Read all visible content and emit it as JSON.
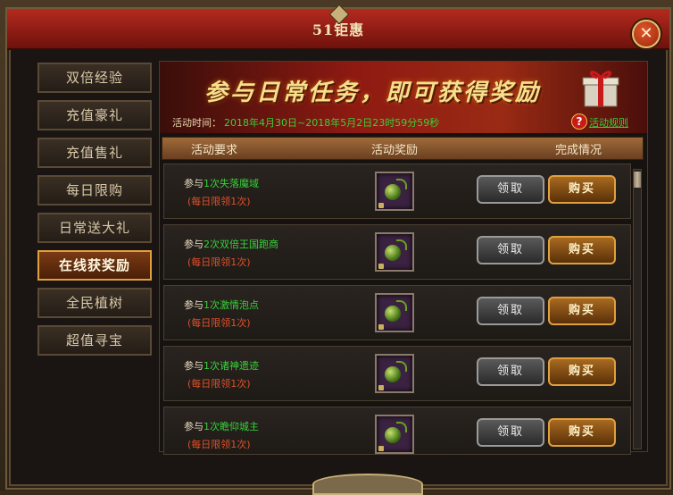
{
  "window": {
    "title": "51钜惠",
    "close_label": "✕"
  },
  "sidebar": {
    "items": [
      {
        "label": "双倍经验",
        "active": false
      },
      {
        "label": "充值豪礼",
        "active": false
      },
      {
        "label": "充值售礼",
        "active": false
      },
      {
        "label": "每日限购",
        "active": false
      },
      {
        "label": "日常送大礼",
        "active": false
      },
      {
        "label": "在线获奖励",
        "active": true
      },
      {
        "label": "全民植树",
        "active": false
      },
      {
        "label": "超值寻宝",
        "active": false
      }
    ]
  },
  "banner": {
    "headline": "参与日常任务，即可获得奖励",
    "time_label": "活动时间：",
    "time_value": "2018年4月30日~2018年5月2日23时59分59秒",
    "rule_icon": "?",
    "rule_link": "活动规则"
  },
  "table": {
    "headers": {
      "requirement": "活动要求",
      "reward": "活动奖励",
      "status": "完成情况"
    },
    "rows": [
      {
        "prefix": "参与",
        "task": "1次失落魔域",
        "limit": "(每日限领1次)",
        "claim": "领取",
        "buy": "购买"
      },
      {
        "prefix": "参与",
        "task": "2次双倍王国跑商",
        "limit": "(每日限领1次)",
        "claim": "领取",
        "buy": "购买"
      },
      {
        "prefix": "参与",
        "task": "1次激情泡点",
        "limit": "(每日限领1次)",
        "claim": "领取",
        "buy": "购买"
      },
      {
        "prefix": "参与",
        "task": "1次诸神遗迹",
        "limit": "(每日限领1次)",
        "claim": "领取",
        "buy": "购买"
      },
      {
        "prefix": "参与",
        "task": "1次瞻仰城主",
        "limit": "(每日限领1次)",
        "claim": "领取",
        "buy": "购买"
      }
    ]
  },
  "colors": {
    "accent_green": "#36d23a",
    "title_red": "#b42a1e",
    "limit_orange": "#e0502a",
    "gold": "#e0a040"
  }
}
